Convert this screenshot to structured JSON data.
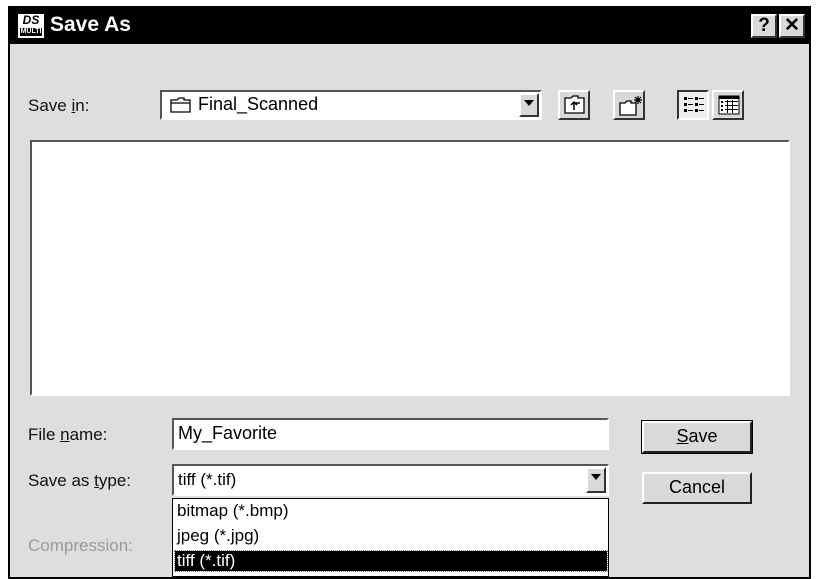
{
  "window": {
    "title": "Save As",
    "app_icon_top": "DS",
    "app_icon_bottom": "MULTI",
    "help_glyph": "?",
    "close_glyph": "✕"
  },
  "save_in": {
    "label_pre": "Save ",
    "label_accel": "i",
    "label_post": "n:",
    "value": "Final_Scanned",
    "icon": "folder-icon"
  },
  "toolbar": {
    "up_icon": "up-one-level-icon",
    "new_folder_icon": "new-folder-icon",
    "list_icon": "list-view-icon",
    "details_icon": "details-view-icon"
  },
  "file_name": {
    "label_pre": "File ",
    "label_accel": "n",
    "label_post": "ame:",
    "value": "My_Favorite"
  },
  "save_as_type": {
    "label_pre": "Save as ",
    "label_accel": "t",
    "label_post": "ype:",
    "value": "tiff (*.tif)",
    "options": [
      "bitmap (*.bmp)",
      "jpeg (*.jpg)",
      "tiff (*.tif)"
    ],
    "selected_index": 2
  },
  "compression": {
    "label": "Compression:"
  },
  "buttons": {
    "save_accel": "S",
    "save_rest": "ave",
    "cancel": "Cancel"
  }
}
